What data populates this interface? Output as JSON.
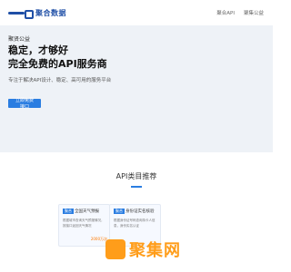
{
  "header": {
    "logo_text": "聚合数据",
    "nav": [
      "聚合API",
      "聚集公益"
    ]
  },
  "hero": {
    "tag": "聚贤公益",
    "title_line1": "稳定，才够好",
    "title_line2": "完全免费的API服务商",
    "subtitle": "专注于解决API设计、稳定、高可用的服务平台",
    "button_label": "立即免费接口"
  },
  "section": {
    "title": "API类目推荐",
    "cards": [
      {
        "badge": "聚合",
        "name": "全国天气预报",
        "desc": "根据城市查询天气预报情况，按接口返回天气情况",
        "price": "2000万次"
      },
      {
        "badge": "聚合",
        "name": "身份证实名核验",
        "desc": "根据身份证号码查询持卡人信息，身份实名认证",
        "price": ""
      }
    ]
  },
  "watermark": {
    "text": "聚集网"
  },
  "colors": {
    "accent": "#2a7de1",
    "hero_bg": "#eef2f7",
    "watermark": "#ff9d1a"
  }
}
